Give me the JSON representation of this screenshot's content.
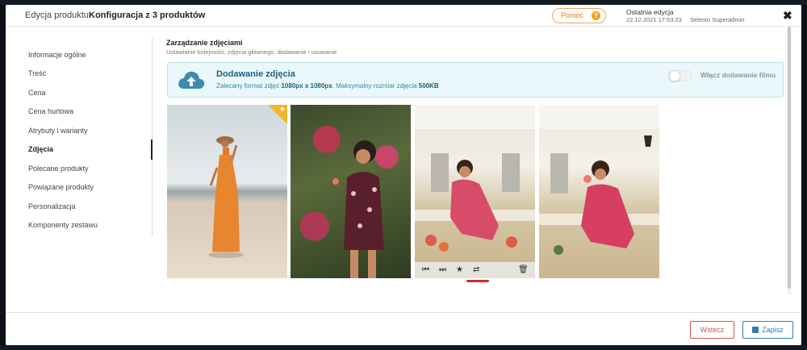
{
  "header": {
    "title_label": "Edycja produktu:",
    "product_name": "Konfiguracja z 3 produktów",
    "help_label": "Pomoc",
    "help_icon": "question-icon",
    "last_edit_title": "Ostatnia edycja",
    "last_edit_date": "22.12.2021   17:53:23",
    "last_edit_user": "Selesto Superadmin"
  },
  "sidebar": {
    "items": [
      {
        "label": "Informacje ogólne"
      },
      {
        "label": "Treść"
      },
      {
        "label": "Cena"
      },
      {
        "label": "Cena hurtowa"
      },
      {
        "label": "Atrybuty i warianty"
      },
      {
        "label": "Zdjęcia"
      },
      {
        "label": "Polecane produkty"
      },
      {
        "label": "Powiązane produkty"
      },
      {
        "label": "Personalizacja"
      },
      {
        "label": "Komponenty zestawu"
      }
    ],
    "active_index": 5
  },
  "section": {
    "title": "Zarządzanie zdjęciami",
    "subtitle": "Ustawianie kolejności, zdjęcia głównego, dodawanie i usuwanie"
  },
  "upload": {
    "title": "Dodawanie zdjęcia",
    "info_prefix": "Zalecany format zdjęć ",
    "info_size": "1080px x 1080px",
    "info_middle": ". Maksymalny rozmiar zdjęcia ",
    "info_max": "500KB",
    "toggle_label": "Włącz dodawanie filmu",
    "toggle_on": false,
    "icon": "cloud-upload-icon"
  },
  "photos": [
    {
      "main": true
    },
    {
      "main": false
    },
    {
      "main": false,
      "hover_toolbar": [
        "move-first-icon",
        "move-last-icon",
        "star-icon",
        "swap-icon",
        "trash-icon"
      ]
    },
    {
      "main": false
    }
  ],
  "footer": {
    "back_label": "Wstecz",
    "save_label": "Zapisz"
  },
  "colors": {
    "accent_orange": "#f0a020",
    "main_star": "#f3b52a",
    "info_blue": "#2d86a8",
    "danger": "#d9534f",
    "primary": "#337ab7"
  }
}
